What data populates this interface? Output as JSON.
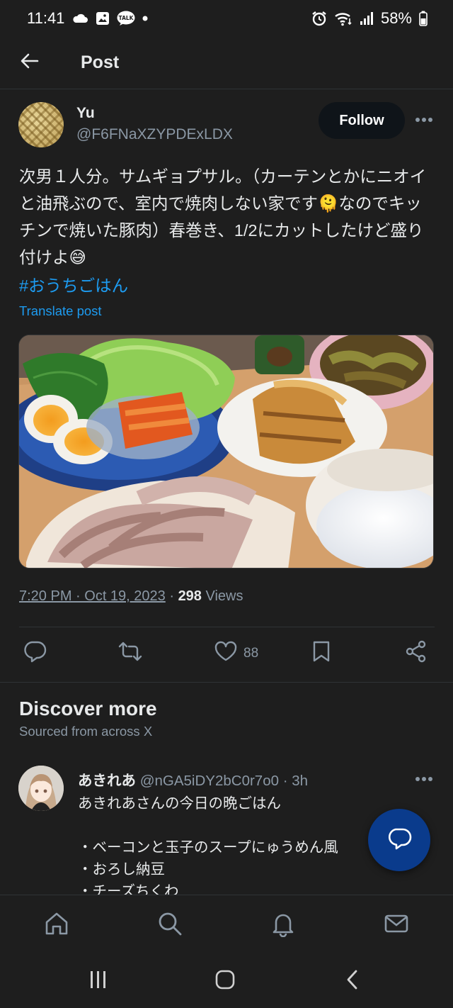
{
  "status_bar": {
    "time": "11:41",
    "talk_badge": "TALK",
    "battery": "58%",
    "left_icons": [
      "cloud-icon",
      "gallery-icon",
      "talk-icon",
      "dot-icon"
    ],
    "right_icons": [
      "alarm-icon",
      "wifi-icon",
      "signal-icon",
      "battery-icon"
    ]
  },
  "header": {
    "title": "Post",
    "back_icon": "arrow-left-icon"
  },
  "post": {
    "author_name": "Yu",
    "author_handle": "@F6FNaXZYPDExLDX",
    "follow_label": "Follow",
    "text": "次男１人分。サムギョプサル。（カーテンとかにニオイと油飛ぶので、室内で焼肉しない家です🫠なのでキッチンで焼いた豚肉）春巻き、1/2にカットしたけど盛り付けよ😅",
    "hashtag": "#おうちごはん",
    "translate_label": "Translate post",
    "timestamp": "7:20 PM · Oct 19, 2023",
    "separator": " · ",
    "views_count": "298",
    "views_label": " Views",
    "media_alt": "Plate of grilled pork slices, lettuce and perilla leaves, soft-boiled eggs, kimchi, spring rolls, rice and eggplant"
  },
  "actions": {
    "reply_icon": "reply-icon",
    "repost_icon": "repost-icon",
    "like_icon": "heart-icon",
    "like_count": "88",
    "bookmark_icon": "bookmark-icon",
    "share_icon": "share-icon"
  },
  "discover": {
    "title": "Discover more",
    "subtitle": "Sourced from across X"
  },
  "reply_post": {
    "name": "あきれあ",
    "handle": "@nGA5iDY2bC0r7o0",
    "dot": " · ",
    "time": "3h",
    "line1": "あきれあさんの今日の晩ごはん",
    "line2": "",
    "line3": "・ベーコンと玉子のスープにゅうめん風",
    "line4": "・おろし納豆",
    "line5": "・チーズちくわ"
  },
  "fab": {
    "icon": "compose-reply-icon"
  },
  "bottom_nav": [
    "home-icon",
    "search-icon",
    "bell-icon",
    "mail-icon"
  ],
  "system_nav": [
    "recents-icon",
    "home-circle-icon",
    "back-chevron-icon"
  ],
  "colors": {
    "accent": "#1d9bf0",
    "background": "#1e1e1e",
    "fab": "#0a3b8c",
    "muted": "#8b98a5"
  }
}
